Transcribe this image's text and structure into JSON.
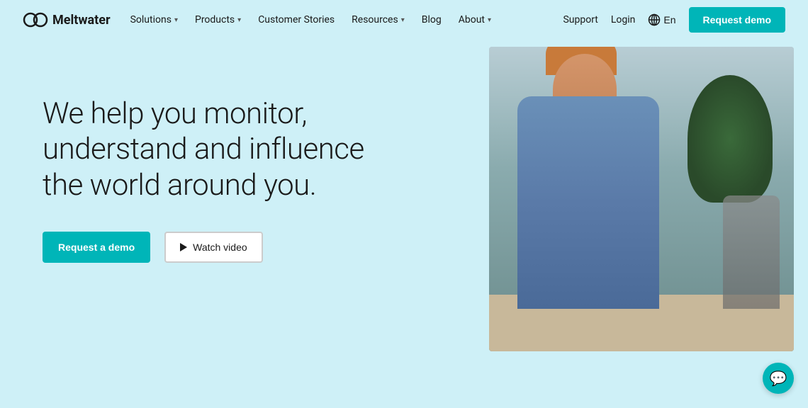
{
  "brand": {
    "name": "Meltwater"
  },
  "nav": {
    "links": [
      {
        "label": "Solutions",
        "hasDropdown": true
      },
      {
        "label": "Products",
        "hasDropdown": true
      },
      {
        "label": "Customer Stories",
        "hasDropdown": false
      },
      {
        "label": "Resources",
        "hasDropdown": true
      },
      {
        "label": "Blog",
        "hasDropdown": false
      },
      {
        "label": "About",
        "hasDropdown": true
      }
    ],
    "right": {
      "support": "Support",
      "login": "Login",
      "lang": "En",
      "requestDemo": "Request demo"
    }
  },
  "hero": {
    "headline": "We help you monitor, understand and influence the world around you.",
    "cta_demo": "Request a demo",
    "cta_video": "Watch video"
  },
  "chat": {
    "label": "Chat"
  }
}
